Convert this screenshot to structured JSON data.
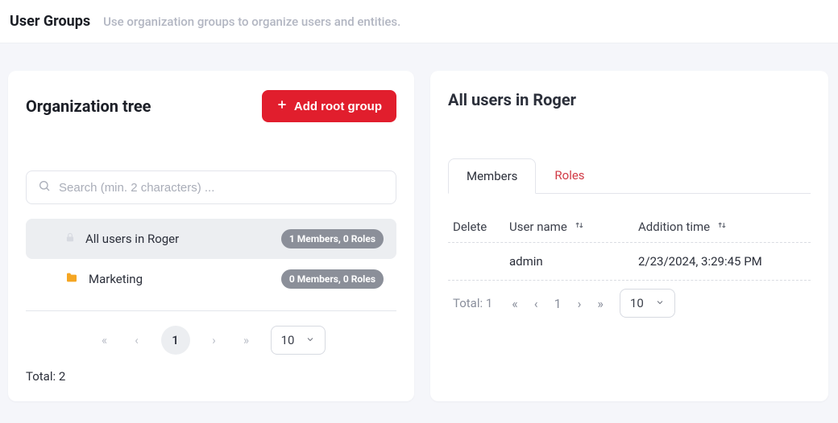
{
  "header": {
    "title": "User Groups",
    "subtitle": "Use organization groups to organize users and entities."
  },
  "left": {
    "title": "Organization tree",
    "add_button": "Add root group",
    "search_placeholder": "Search (min. 2 characters) ...",
    "rows": [
      {
        "label": "All users in Roger",
        "badge": "1 Members, 0 Roles",
        "icon": "lock",
        "selected": true
      },
      {
        "label": "Marketing",
        "badge": "0 Members, 0 Roles",
        "icon": "folder",
        "selected": false
      }
    ],
    "pagination": {
      "page": "1",
      "pagesize": "10"
    },
    "total_label": "Total: 2"
  },
  "right": {
    "title": "All users in Roger",
    "tabs": {
      "members": "Members",
      "roles": "Roles"
    },
    "columns": {
      "delete": "Delete",
      "username": "User name",
      "addition": "Addition time"
    },
    "rows": [
      {
        "username": "admin",
        "addition": "2/23/2024, 3:29:45 PM"
      }
    ],
    "footer": {
      "total": "Total: 1",
      "page": "1",
      "pagesize": "10"
    }
  }
}
